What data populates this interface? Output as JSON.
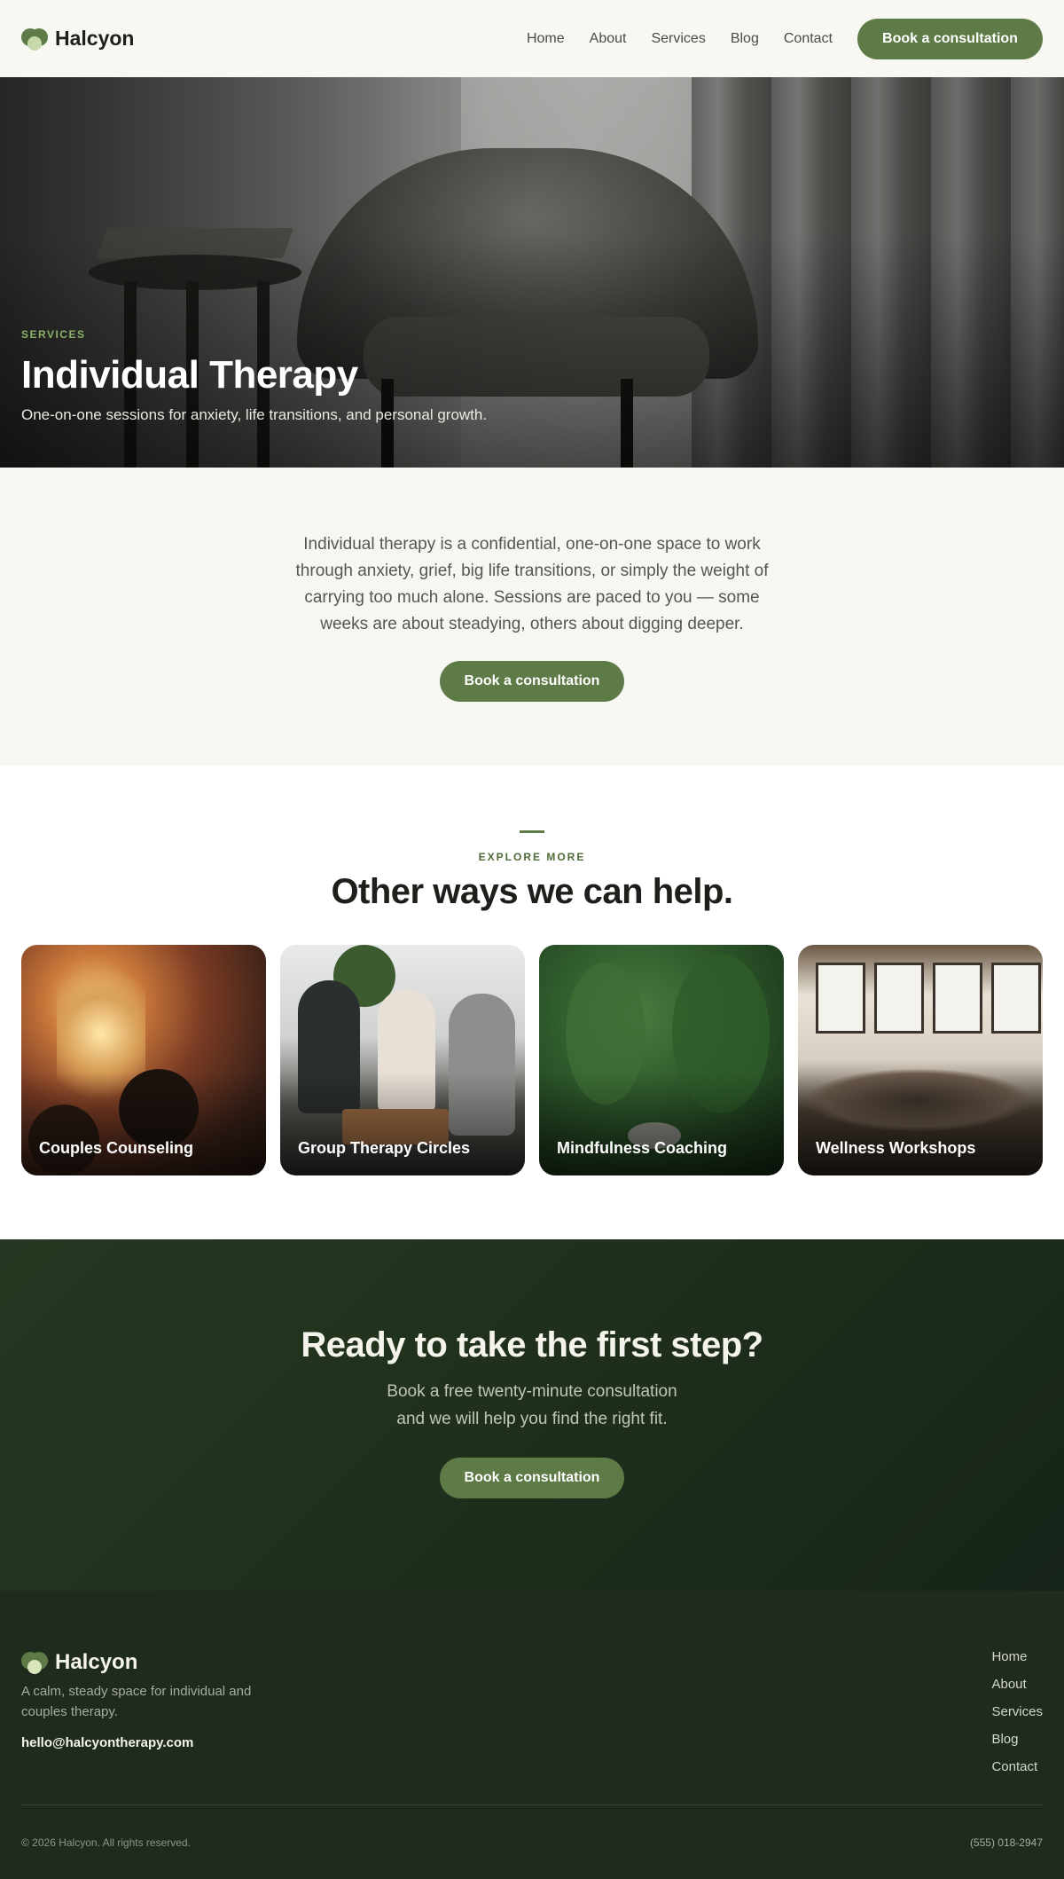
{
  "header": {
    "brand": "Halcyon",
    "nav": [
      "Home",
      "About",
      "Services",
      "Blog",
      "Contact"
    ],
    "cta_label": "Book a consultation"
  },
  "hero": {
    "eyebrow": "SERVICES",
    "title": "Individual Therapy",
    "subtitle": "One-on-one sessions for anxiety, life transitions, and personal growth."
  },
  "intro": {
    "body": "Individual therapy is a confidential, one-on-one space to work through anxiety, grief, big life transitions, or simply the weight of carrying too much alone. Sessions are paced to you — some weeks are about steadying, others about digging deeper.",
    "cta_label": "Book a consultation"
  },
  "explore": {
    "eyebrow": "EXPLORE MORE",
    "title": "Other ways we can help.",
    "cards": [
      {
        "label": "Couples Counseling"
      },
      {
        "label": "Group Therapy Circles"
      },
      {
        "label": "Mindfulness Coaching"
      },
      {
        "label": "Wellness Workshops"
      }
    ]
  },
  "cta": {
    "title": "Ready to take the first step?",
    "body": "Book a free twenty-minute consultation and we will help you find the right fit.",
    "cta_label": "Book a consultation"
  },
  "footer": {
    "brand": "Halcyon",
    "tagline": "A calm, steady space for individual and couples therapy.",
    "email": "hello@halcyontherapy.com",
    "nav": [
      "Home",
      "About",
      "Services",
      "Blog",
      "Contact"
    ],
    "copyright": "© 2026 Halcyon. All rights reserved.",
    "phone": "(555) 018-2947"
  },
  "colors": {
    "accent": "#5e7b47",
    "dark_green": "#1f2b1d",
    "background": "#f7f7f1"
  }
}
